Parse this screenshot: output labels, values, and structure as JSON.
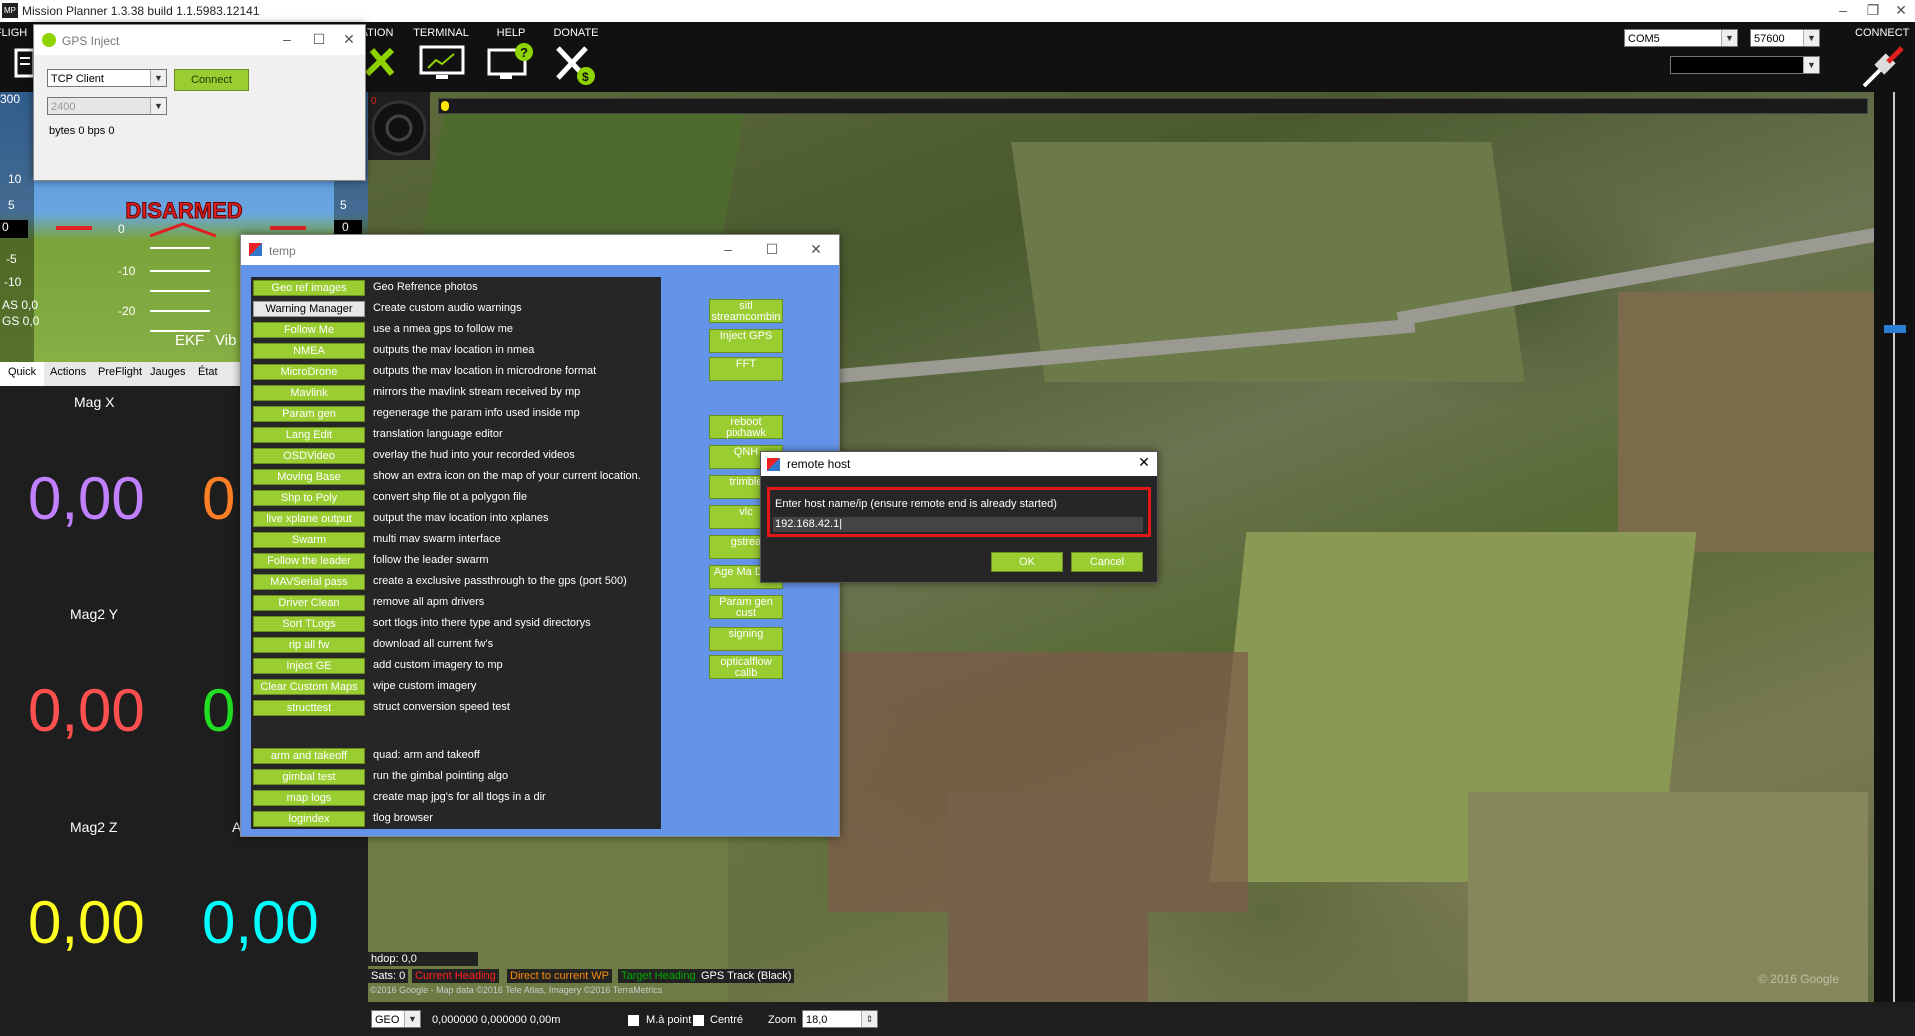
{
  "titlebar": {
    "title": "Mission Planner 1.3.38 build 1.1.5983.12141",
    "logo": "MP"
  },
  "toolbar": {
    "items": [
      {
        "label": "FLIGH"
      },
      {
        "label": "ATION"
      },
      {
        "label": "TERMINAL"
      },
      {
        "label": "HELP"
      },
      {
        "label": "DONATE"
      }
    ],
    "port": "COM5",
    "baud": "57600",
    "connect_label": "CONNECT"
  },
  "hud": {
    "status": "DISARMED",
    "ticks_left": [
      "300",
      "10",
      "5",
      "0",
      "-5",
      "-10"
    ],
    "pitch": [
      "0",
      "-10",
      "-20"
    ],
    "ticks_right": [
      "10",
      "5",
      "0"
    ],
    "as": "AS 0,0",
    "gs": "GS 0,0",
    "ekf": "EKF",
    "vibe": "Vib"
  },
  "tabs": [
    "Quick",
    "Actions",
    "PreFlight",
    "Jauges",
    "État"
  ],
  "quick": {
    "items": [
      {
        "label": "Mag X",
        "value": "0,00",
        "color": "#c080ff"
      },
      {
        "label": "",
        "value": "0",
        "color": "#ff7f27"
      },
      {
        "label": "Mag2 Y",
        "value": "0,00",
        "color": "#ff5050"
      },
      {
        "label": "",
        "value": "0",
        "color": "#22dd22"
      },
      {
        "label": "Mag2 Z",
        "value": "0,00",
        "color": "#ffff22"
      },
      {
        "label": "A",
        "value": "0,00",
        "color": "#00ffff"
      }
    ]
  },
  "gps_inject": {
    "title": "GPS Inject",
    "mode": "TCP Client",
    "baud": "2400",
    "connect": "Connect",
    "stats": "bytes 0 bps 0"
  },
  "temp": {
    "title": "temp",
    "rows": [
      {
        "btn": "Geo ref images",
        "desc": "Geo Refrence photos"
      },
      {
        "btn": "Warning Manager",
        "desc": "Create custom audio warnings"
      },
      {
        "btn": "Follow Me",
        "desc": "use a nmea gps to follow me"
      },
      {
        "btn": "NMEA",
        "desc": "outputs the mav location in nmea"
      },
      {
        "btn": "MicroDrone",
        "desc": "outputs the mav location in microdrone format"
      },
      {
        "btn": "Mavlink",
        "desc": "mirrors the mavlink stream received by mp"
      },
      {
        "btn": "Param gen",
        "desc": "regenerage the param info used inside mp"
      },
      {
        "btn": "Lang Edit",
        "desc": "translation language editor"
      },
      {
        "btn": "OSDVideo",
        "desc": "overlay the hud into your recorded videos"
      },
      {
        "btn": "Moving Base",
        "desc": "show an extra icon on the map of your current location."
      },
      {
        "btn": "Shp to Poly",
        "desc": "convert shp file ot a polygon file"
      },
      {
        "btn": "live xplane output",
        "desc": "output the mav location into xplanes"
      },
      {
        "btn": "Swarm",
        "desc": "multi mav swarm interface"
      },
      {
        "btn": "Follow the leader",
        "desc": "follow the leader swarm"
      },
      {
        "btn": "MAVSerial pass",
        "desc": "create a exclusive passthrough to the gps (port 500)"
      },
      {
        "btn": "Driver Clean",
        "desc": "remove all apm drivers"
      },
      {
        "btn": "Sort TLogs",
        "desc": "sort tlogs into there type and sysid directorys"
      },
      {
        "btn": "rip all fw",
        "desc": "download all current fw's"
      },
      {
        "btn": "Inject GE",
        "desc": "add custom imagery to mp"
      },
      {
        "btn": "Clear Custom Maps",
        "desc": "wipe custom imagery"
      },
      {
        "btn": "structtest",
        "desc": "struct conversion speed test"
      }
    ],
    "rows2": [
      {
        "btn": "arm and takeoff",
        "desc": "quad: arm and takeoff"
      },
      {
        "btn": "gimbal test",
        "desc": "run the gimbal pointing algo"
      },
      {
        "btn": "map logs",
        "desc": "create map jpg's for all tlogs in a dir"
      },
      {
        "btn": "logindex",
        "desc": "tlog browser"
      }
    ],
    "right_buttons": [
      "sitl streamcombin",
      "Inject GPS",
      "FFT",
      "reboot pixhawk",
      "QNH",
      "trimble",
      "vlc",
      "gstrea",
      "Age Ma Data",
      "Param gen cust",
      "signing",
      "opticalflow calib"
    ]
  },
  "remote_host": {
    "title": "remote host",
    "prompt": "Enter host name/ip (ensure remote end is already started)",
    "value": "192.168.42.1",
    "ok": "OK",
    "cancel": "Cancel"
  },
  "map": {
    "hdop": "hdop: 0,0",
    "sats": "Sats: 0",
    "legend": [
      {
        "text": "Current Heading",
        "color": "#ff2020"
      },
      {
        "text": "Direct to current WP",
        "color": "#ff8c00"
      },
      {
        "text": "Target Heading",
        "color": "#00aa00"
      },
      {
        "text": "GPS Track (Black)",
        "color": "#ffffff"
      }
    ],
    "copyright": "©2016 Google - Map data ©2016 Tele Atlas, Imagery ©2016 TerraMetrics",
    "wm": "© 2016 Google"
  },
  "bottom": {
    "geo": "GEO",
    "coords": "0,000000 0,000000  0,00m",
    "map_point": "M.à point",
    "center": "Centré",
    "zoom_label": "Zoom",
    "zoom": "18,0"
  }
}
